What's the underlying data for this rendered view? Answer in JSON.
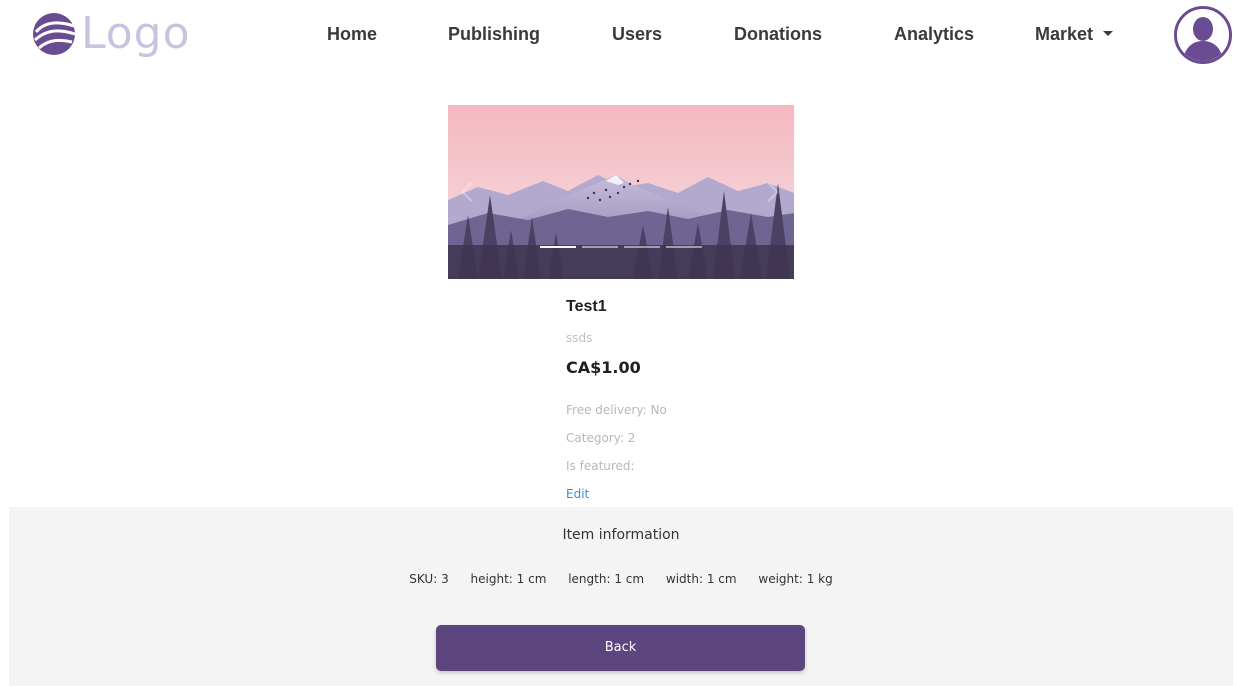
{
  "brand": {
    "logo_text": "Logo",
    "logo_color": "#c9c3e0",
    "logo_mark_color": "#6a4c93"
  },
  "nav": {
    "home": "Home",
    "publishing": "Publishing",
    "users": "Users",
    "donations": "Donations",
    "analytics": "Analytics",
    "market": "Market"
  },
  "user": {
    "avatar_icon": "user-avatar-icon",
    "accent": "#6a4c93"
  },
  "carousel": {
    "slide_count": 4,
    "active_slide": 1,
    "image": "mountain-landscape",
    "colors": {
      "sky_top": "#f6b8c0",
      "sky_bottom": "#f0d6dc",
      "mountains": "#8f87b5",
      "forest": "#4a3f5c"
    }
  },
  "item": {
    "title": "Test1",
    "description": "ssds",
    "price": "CA$1.00",
    "free_delivery": "Free delivery: No",
    "category": "Category: 2",
    "is_featured": "Is featured:",
    "edit_label": "Edit"
  },
  "info": {
    "heading": "Item information",
    "sku": "SKU: 3",
    "height": "height: 1 cm",
    "length": "length: 1 cm",
    "width": "width: 1 cm",
    "weight": "weight: 1 kg"
  },
  "actions": {
    "back_label": "Back",
    "back_color": "#5d467f"
  }
}
